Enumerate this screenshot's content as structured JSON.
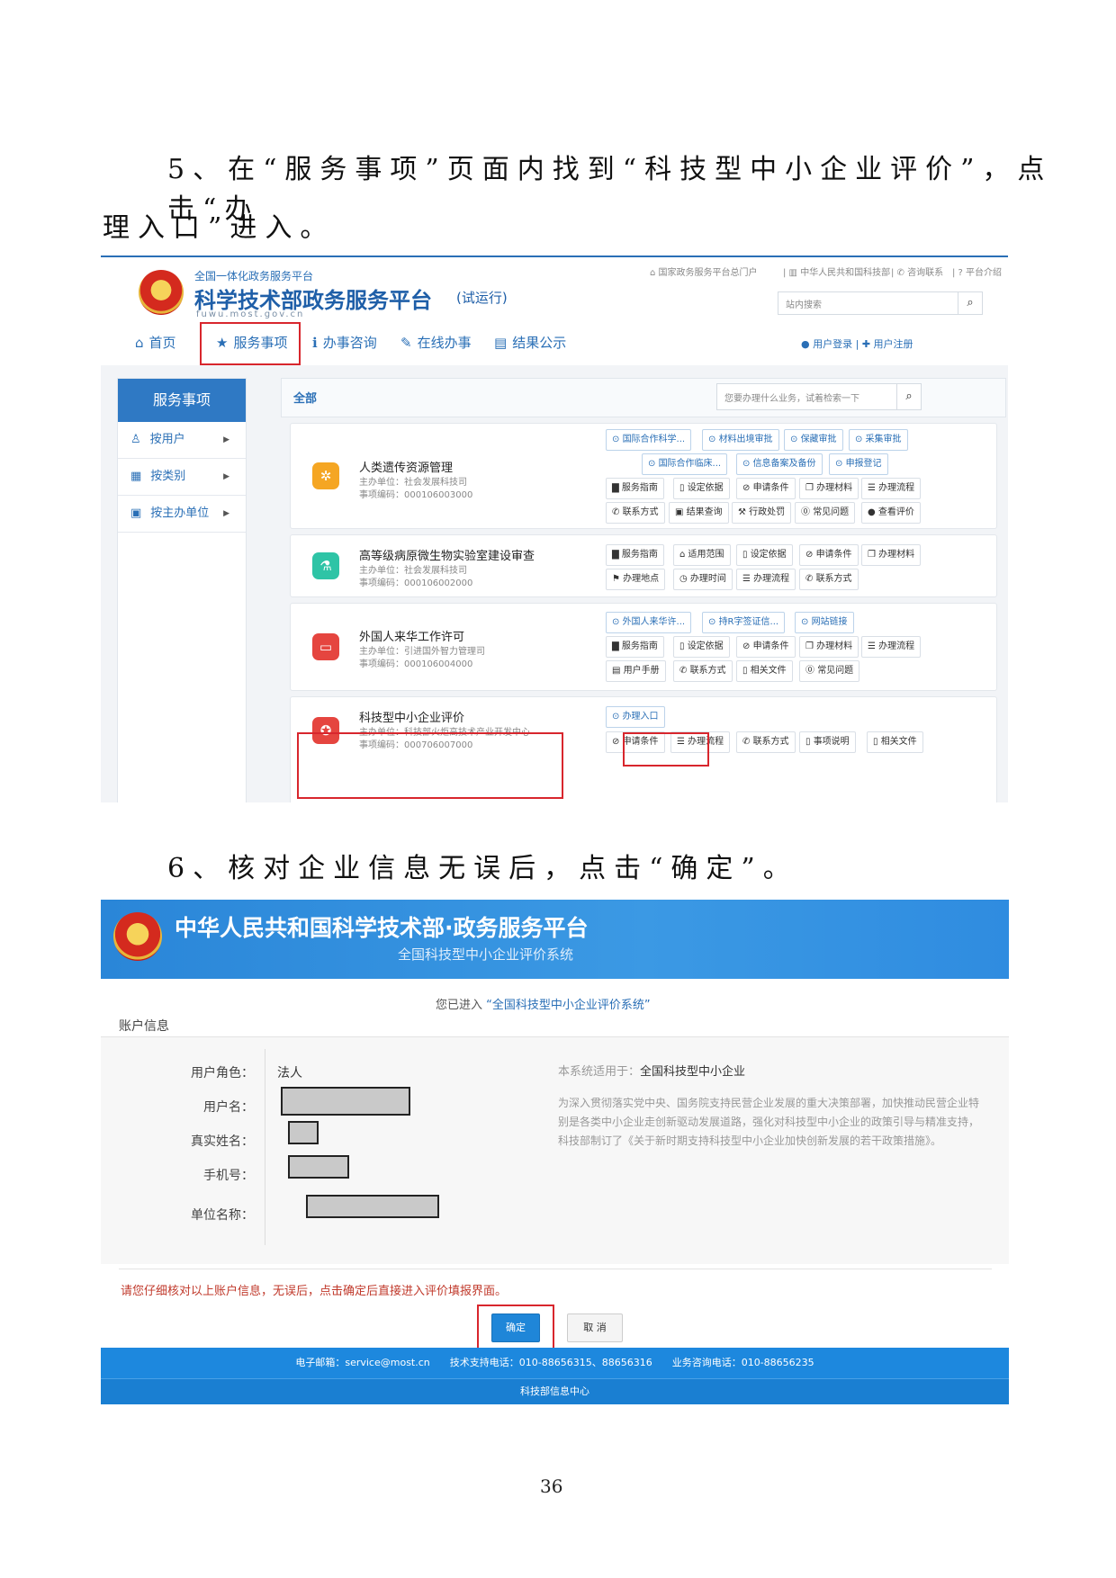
{
  "step5": {
    "line1": "5、在“服务事项”页面内找到“科技型中小企业评价”，点击“办",
    "line2": "理入口”进入。"
  },
  "step6": "6、核对企业信息无误后，点击“确定”。",
  "page_number": "36",
  "shot1": {
    "platform_top": "全国一体化政务服务平台",
    "platform_title": "科学技术部政务服务平台",
    "trial": "(试运行)",
    "domain": "fuwu.most.gov.cn",
    "top_links": [
      "国家政务服务平台总门户",
      "中华人民共和国科技部",
      "咨询联系",
      "平台介绍"
    ],
    "site_search_placeholder": "站内搜索",
    "nav": [
      "首页",
      "服务事项",
      "办事咨询",
      "在线办事",
      "结果公示"
    ],
    "login": "用户登录",
    "register": "用户注册",
    "sidebar_title": "服务事项",
    "sidebar_items": [
      "按用户",
      "按类别",
      "按主办单位"
    ],
    "tab_all": "全部",
    "item_search_placeholder": "您要办理什么业务，试着检索一下",
    "cards": [
      {
        "title": "人类遗传资源管理",
        "unit": "主办单位：社会发展科技司",
        "code": "事项编码：000106003000",
        "tags1": [
          "国际合作科学...",
          "材料出境审批",
          "保藏审批",
          "采集审批"
        ],
        "tags2": [
          "国际合作临床...",
          "信息备案及备份",
          "申报登记"
        ],
        "row1": [
          "服务指南",
          "设定依据",
          "申请条件",
          "办理材料",
          "办理流程"
        ],
        "row2": [
          "联系方式",
          "结果查询",
          "行政处罚",
          "常见问题",
          "查看评价"
        ]
      },
      {
        "title": "高等级病原微生物实验室建设审查",
        "unit": "主办单位：社会发展科技司",
        "code": "事项编码：000106002000",
        "row1": [
          "服务指南",
          "适用范围",
          "设定依据",
          "申请条件",
          "办理材料"
        ],
        "row2": [
          "办理地点",
          "办理时间",
          "办理流程",
          "联系方式"
        ]
      },
      {
        "title": "外国人来华工作许可",
        "unit": "主办单位：引进国外智力管理司",
        "code": "事项编码：000106004000",
        "tags1": [
          "外国人来华许...",
          "持R字签证信...",
          "网站链接"
        ],
        "row1": [
          "服务指南",
          "设定依据",
          "申请条件",
          "办理材料",
          "办理流程"
        ],
        "row2": [
          "用户手册",
          "联系方式",
          "相关文件",
          "常见问题"
        ]
      },
      {
        "title": "科技型中小企业评价",
        "unit": "主办单位：科技部火炬高技术产业开发中心",
        "code": "事项编码：000706007000",
        "tags1": [
          "办理入口"
        ],
        "row1": [
          "申请条件",
          "办理流程",
          "联系方式",
          "事项说明",
          "相关文件"
        ]
      }
    ]
  },
  "shot2": {
    "title": "中华人民共和国科学技术部·政务服务平台",
    "subtitle": "全国科技型中小企业评价系统",
    "entered_prefix": "您已进入",
    "entered_system": "“全国科技型中小企业评价系统”",
    "tab": "账户信息",
    "fields": [
      {
        "label": "用户角色：",
        "value": "法人"
      },
      {
        "label": "用户名：",
        "value": ""
      },
      {
        "label": "真实姓名：",
        "value": ""
      },
      {
        "label": "手机号：",
        "value": ""
      },
      {
        "label": "单位名称：",
        "value": ""
      }
    ],
    "applies_label": "本系统适用于：",
    "applies_value": "全国科技型中小企业",
    "description": "为深入贯彻落实党中央、国务院支持民营企业发展的重大决策部署，加快推动民营企业特别是各类中小企业走创新驱动发展道路，强化对科技型中小企业的政策引导与精准支持，科技部制订了《关于新时期支持科技型中小企业加快创新发展的若干政策措施》。",
    "warning": "请您仔细核对以上账户信息，无误后，点击确定后直接进入评价填报界面。",
    "confirm": "确定",
    "cancel": "取 消",
    "footer_contact": "电子邮箱：service@most.cn　　技术支持电话：010-88656315、88656316　　业务咨询电话：010-88656235",
    "footer_org": "科技部信息中心"
  }
}
